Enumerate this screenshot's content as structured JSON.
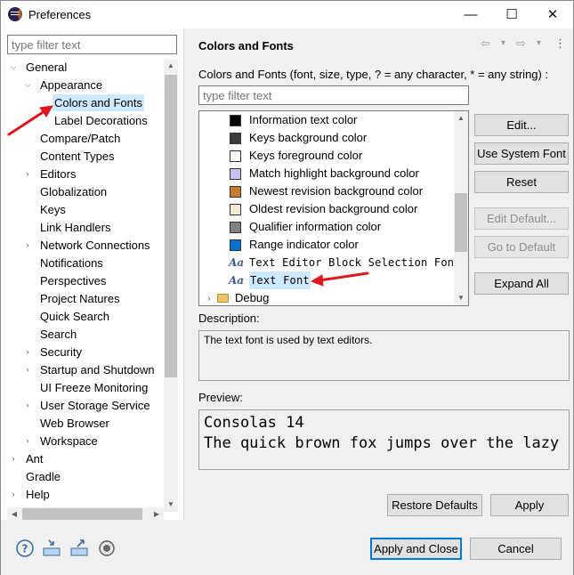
{
  "window": {
    "title": "Preferences",
    "minimize": "—",
    "maximize": "☐",
    "close": "✕"
  },
  "left": {
    "filter_placeholder": "type filter text",
    "tree": [
      {
        "label": "General",
        "arrow": "⌵",
        "level": 0
      },
      {
        "label": "Appearance",
        "arrow": "⌵",
        "level": 1
      },
      {
        "label": "Colors and Fonts",
        "arrow": "",
        "level": 2,
        "selected": true
      },
      {
        "label": "Label Decorations",
        "arrow": "",
        "level": 2
      },
      {
        "label": "Compare/Patch",
        "arrow": "",
        "level": 1
      },
      {
        "label": "Content Types",
        "arrow": "",
        "level": 1
      },
      {
        "label": "Editors",
        "arrow": "›",
        "level": 1
      },
      {
        "label": "Globalization",
        "arrow": "",
        "level": 1
      },
      {
        "label": "Keys",
        "arrow": "",
        "level": 1
      },
      {
        "label": "Link Handlers",
        "arrow": "",
        "level": 1
      },
      {
        "label": "Network Connections",
        "arrow": "›",
        "level": 1
      },
      {
        "label": "Notifications",
        "arrow": "",
        "level": 1
      },
      {
        "label": "Perspectives",
        "arrow": "",
        "level": 1
      },
      {
        "label": "Project Natures",
        "arrow": "",
        "level": 1
      },
      {
        "label": "Quick Search",
        "arrow": "",
        "level": 1
      },
      {
        "label": "Search",
        "arrow": "",
        "level": 1
      },
      {
        "label": "Security",
        "arrow": "›",
        "level": 1
      },
      {
        "label": "Startup and Shutdown",
        "arrow": "›",
        "level": 1
      },
      {
        "label": "UI Freeze Monitoring",
        "arrow": "",
        "level": 1
      },
      {
        "label": "User Storage Service",
        "arrow": "›",
        "level": 1
      },
      {
        "label": "Web Browser",
        "arrow": "",
        "level": 1
      },
      {
        "label": "Workspace",
        "arrow": "›",
        "level": 1
      },
      {
        "label": "Ant",
        "arrow": "›",
        "level": 0
      },
      {
        "label": "Gradle",
        "arrow": "",
        "level": 0
      },
      {
        "label": "Help",
        "arrow": "›",
        "level": 0
      }
    ]
  },
  "right": {
    "title": "Colors and Fonts",
    "nav": {
      "back": "⇦",
      "back_menu": "▾",
      "forward": "⇨",
      "forward_menu": "▾",
      "menu": "⋮"
    },
    "description_line": "Colors and Fonts (font, size, type, ? = any character, * = any string) :",
    "filter_placeholder": "type filter text",
    "items": [
      {
        "label": "Information text color",
        "kind": "color",
        "color": "#000000"
      },
      {
        "label": "Keys background color",
        "kind": "color",
        "color": "#3c3c3c"
      },
      {
        "label": "Keys foreground color",
        "kind": "color",
        "color": "#ffffff"
      },
      {
        "label": "Match highlight background color",
        "kind": "color",
        "color": "#c8c0f0"
      },
      {
        "label": "Newest revision background color",
        "kind": "color",
        "color": "#c57a2e"
      },
      {
        "label": "Oldest revision background color",
        "kind": "color",
        "color": "#f5ead6"
      },
      {
        "label": "Qualifier information color",
        "kind": "color",
        "color": "#808080"
      },
      {
        "label": "Range indicator color",
        "kind": "color",
        "color": "#0073d0"
      },
      {
        "label": "Text Editor Block Selection Font",
        "kind": "font",
        "glyph": "Aa"
      },
      {
        "label": "Text Font",
        "kind": "font",
        "glyph": "Aa",
        "selected": true
      }
    ],
    "debug_label": "Debug",
    "buttons": {
      "edit": "Edit...",
      "use_system_font": "Use System Font",
      "reset": "Reset",
      "edit_default": "Edit Default...",
      "go_to_default": "Go to Default",
      "expand_all": "Expand All"
    },
    "description_label": "Description:",
    "description_text": "The text font is used by text editors.",
    "preview_label": "Preview:",
    "preview_lines": [
      "Consolas 14",
      "The quick brown fox jumps over the lazy d"
    ],
    "restore_defaults": "Restore Defaults",
    "apply": "Apply"
  },
  "bottom": {
    "apply_and_close": "Apply and Close",
    "cancel": "Cancel"
  },
  "accent": "#0078d7",
  "annotation_color": "#e0161e"
}
